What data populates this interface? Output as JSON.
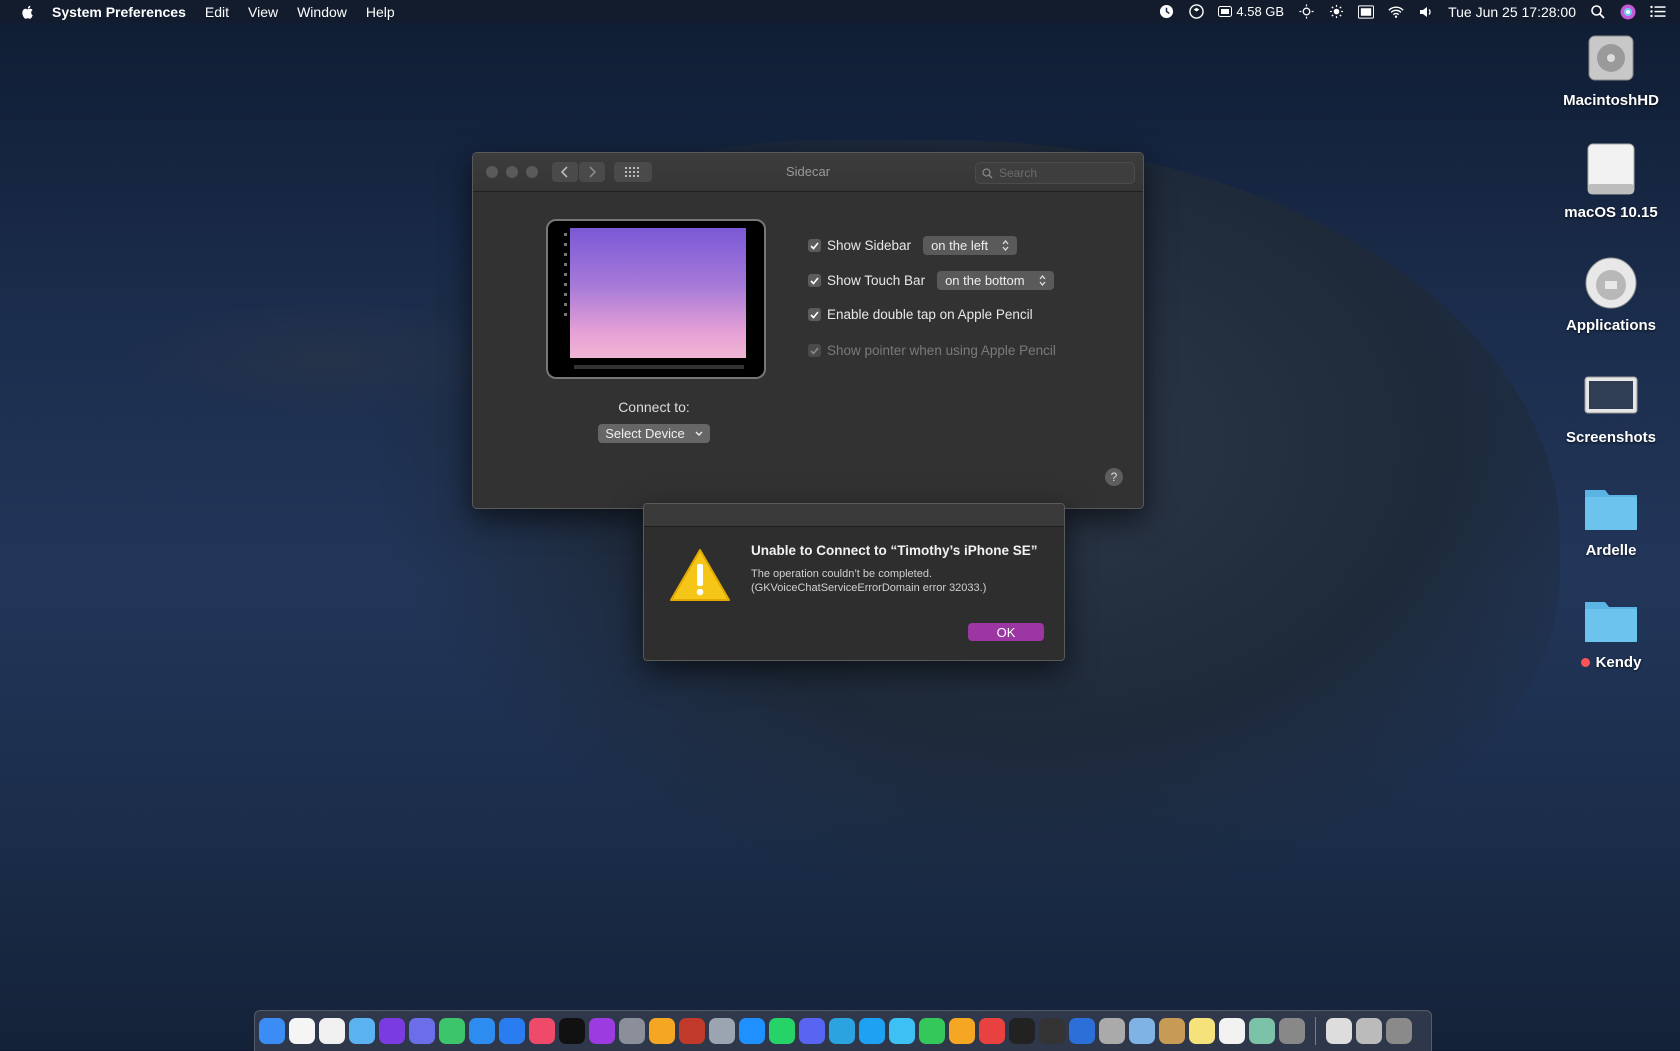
{
  "menubar": {
    "app_name": "System Preferences",
    "menus": [
      "Edit",
      "View",
      "Window",
      "Help"
    ],
    "battery_text": "4.58 GB",
    "clock": "Tue Jun 25  17:28:00"
  },
  "desktop_icons": [
    {
      "label": "MacintoshHD",
      "icon": "hard-drive-icon"
    },
    {
      "label": "macOS 10.15",
      "icon": "external-drive-icon"
    },
    {
      "label": "Applications",
      "icon": "macos-disk-icon"
    },
    {
      "label": "Screenshots",
      "icon": "screenshots-icon"
    },
    {
      "label": "Ardelle",
      "icon": "folder-icon"
    },
    {
      "label": "Kendy",
      "icon": "folder-icon",
      "tag_color": "#ff5257"
    }
  ],
  "prefs_window": {
    "title": "Sidecar",
    "search_placeholder": "Search",
    "connect_label": "Connect to:",
    "select_device": "Select Device",
    "options": {
      "show_sidebar": {
        "label": "Show Sidebar",
        "checked": true,
        "value": "on the left"
      },
      "show_touchbar": {
        "label": "Show Touch Bar",
        "checked": true,
        "value": "on the bottom"
      },
      "double_tap": {
        "label": "Enable double tap on Apple Pencil",
        "checked": true
      },
      "show_pointer": {
        "label": "Show pointer when using Apple Pencil",
        "checked": true,
        "disabled": true
      }
    },
    "help_label": "?"
  },
  "alert": {
    "title": "Unable to Connect to “Timothy’s iPhone SE”",
    "line1": "The operation couldn’t be completed.",
    "line2": "(GKVoiceChatServiceErrorDomain error 32033.)",
    "ok_label": "OK",
    "accent": "#9b36a3"
  },
  "dock": {
    "apps": [
      "finder",
      "clock",
      "calendar",
      "cloud-weather",
      "siri",
      "safari-compass",
      "maps",
      "safari",
      "app-store",
      "music",
      "apple-tv",
      "podcasts",
      "launchpad",
      "photos",
      "photo-booth",
      "preview",
      "messenger",
      "whatsapp",
      "discord",
      "telegram",
      "twitter",
      "messages",
      "facetime",
      "home",
      "news",
      "stocks",
      "activity-monitor",
      "browser",
      "disk-utility",
      "image-capture",
      "contacts",
      "notes",
      "textedit",
      "preview-2",
      "system-preferences",
      "trash-sep",
      "downloads",
      "documents",
      "trash"
    ]
  }
}
